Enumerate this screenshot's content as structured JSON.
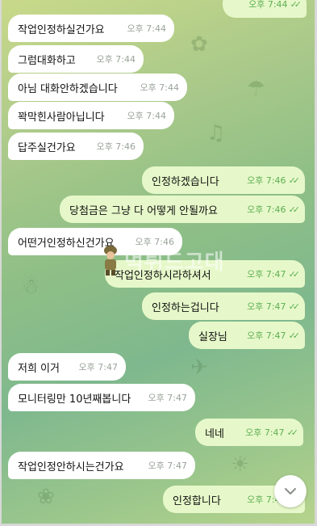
{
  "messages": [
    {
      "dir": "out",
      "text": "",
      "time": "오후 7:44"
    },
    {
      "dir": "in",
      "text": "작업인정하실건가요",
      "time": "오후 7:44"
    },
    {
      "dir": "in",
      "text": "그럼대화하고",
      "time": "오후 7:44"
    },
    {
      "dir": "in",
      "text": "아님 대화안하겠습니다",
      "time": "오후 7:44"
    },
    {
      "dir": "in",
      "text": "꽉막힌사람아닙니다",
      "time": "오후 7:44"
    },
    {
      "dir": "in",
      "text": "답주실건가요",
      "time": "오후 7:46"
    },
    {
      "dir": "out",
      "text": "인정하겠습니다",
      "time": "오후 7:46"
    },
    {
      "dir": "out",
      "text": "당첨금은 그냥 다 어떻게 안될까요",
      "time": "오후 7:46"
    },
    {
      "dir": "in",
      "text": "어떤거인정하신건가요",
      "time": "오후 7:46"
    },
    {
      "dir": "out",
      "text": "작업인정하시라하셔서",
      "time": "오후 7:47"
    },
    {
      "dir": "out",
      "text": "인정하는겁니다",
      "time": "오후 7:47"
    },
    {
      "dir": "out",
      "text": "실장님",
      "time": "오후 7:47"
    },
    {
      "dir": "in",
      "text": "저희 이거",
      "time": "오후 7:47"
    },
    {
      "dir": "in",
      "text": "모니터링만 10년째봅니다",
      "time": "오후 7:47"
    },
    {
      "dir": "out",
      "text": "네네",
      "time": "오후 7:47"
    },
    {
      "dir": "in",
      "text": "작업인정안하시는건가요",
      "time": "오후 7:47"
    },
    {
      "dir": "out",
      "text": "인정합니다",
      "time": "오후 7:47"
    }
  ],
  "watermark": "먹튀드고대",
  "icons": {
    "scroll_down": "chevron-down-icon",
    "read_receipt": "double-check-icon"
  }
}
